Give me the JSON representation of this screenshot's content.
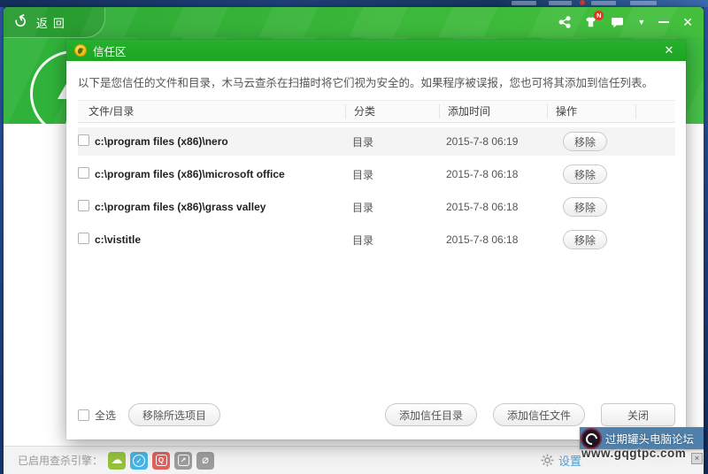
{
  "desktop": {
    "artifact_glyph": "×"
  },
  "main_window": {
    "back_label": "返回",
    "titlebar": {
      "back_glyph": "↺",
      "badge": "N",
      "menu_glyph": "▼",
      "close_glyph": "✕"
    },
    "status_bar": {
      "label": "已启用查杀引擎：",
      "engines": [
        {
          "name": "cloud-engine",
          "color": "#95c13d",
          "char": "☁",
          "wrap": "none"
        },
        {
          "name": "qvm-engine",
          "color": "#47b4e4",
          "char": "✓",
          "wrap": "circle"
        },
        {
          "name": "qex-engine",
          "color": "#e0605c",
          "char": "Q",
          "wrap": "square"
        },
        {
          "name": "repair-engine",
          "color": "#9c9c9c",
          "char": "↗",
          "wrap": "square"
        },
        {
          "name": "avira-engine",
          "color": "#9c9c9c",
          "char": "⌀",
          "wrap": "none"
        }
      ]
    },
    "settings_label": "设置"
  },
  "dialog": {
    "title": "信任区",
    "close_glyph": "✕",
    "description": "以下是您信任的文件和目录，木马云查杀在扫描时将它们视为安全的。如果程序被误报，您也可将其添加到信任列表。",
    "table": {
      "columns": [
        "文件/目录",
        "分类",
        "添加时间",
        "操作"
      ],
      "rows": [
        {
          "path": "c:\\program files (x86)\\nero",
          "category": "目录",
          "added": "2015-7-8 06:19",
          "action": "移除"
        },
        {
          "path": "c:\\program files (x86)\\microsoft office",
          "category": "目录",
          "added": "2015-7-8 06:18",
          "action": "移除"
        },
        {
          "path": "c:\\program files (x86)\\grass valley",
          "category": "目录",
          "added": "2015-7-8 06:18",
          "action": "移除"
        },
        {
          "path": "c:\\vistitle",
          "category": "目录",
          "added": "2015-7-8 06:18",
          "action": "移除"
        }
      ]
    },
    "footer": {
      "select_all_label": "全选",
      "remove_selected_label": "移除所选项目",
      "add_dir_label": "添加信任目录",
      "add_file_label": "添加信任文件",
      "close_label": "关闭"
    }
  },
  "watermark": {
    "forum": "过期罐头电脑论坛",
    "url": "www.gqgtpc.com"
  }
}
